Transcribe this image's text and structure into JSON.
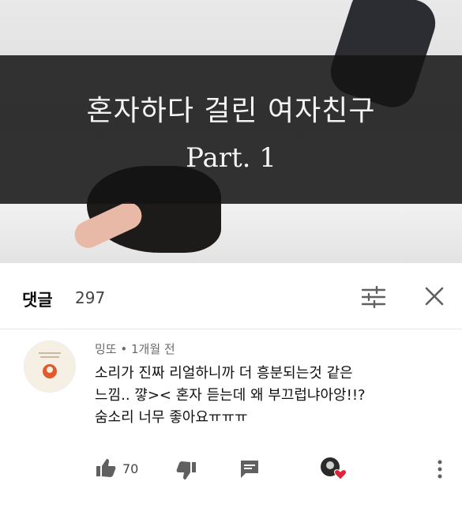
{
  "video": {
    "title_line1": "혼자하다 걸린 여자친구",
    "title_line2": "Part. 1"
  },
  "comments_header": {
    "label": "댓글",
    "count": "297"
  },
  "comment": {
    "meta": "밍또 • 1개월 전",
    "lines": [
      "소리가 진짜 리얼하니까 더 흥분되는것 같은",
      "느낌.. 꺟><  혼자 듣는데 왜 부끄럽냐아앙!!?",
      "숨소리 너무 좋아요ㅠㅠㅠ"
    ],
    "like_count": "70"
  },
  "icons": [
    "sort-icon",
    "close-icon",
    "like-icon",
    "dislike-icon",
    "reply-icon",
    "creator-heart-icon",
    "more-vert-icon"
  ],
  "colors": {
    "banner": "#141414",
    "heart": "#e0233a",
    "icon": "#606060"
  }
}
